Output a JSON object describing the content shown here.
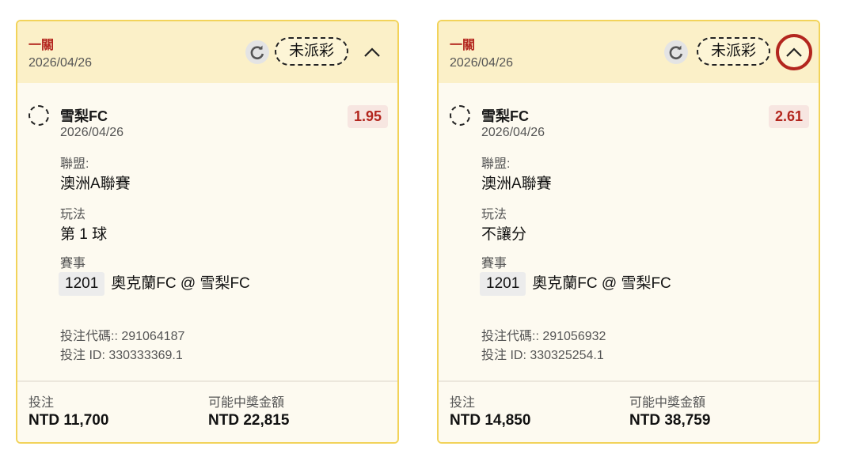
{
  "cards": [
    {
      "bet_type": "一關",
      "date": "2026/04/26",
      "status": "未派彩",
      "selection": {
        "team": "雪梨FC",
        "date": "2026/04/26",
        "odds": "1.95",
        "league_label": "聯盟:",
        "league": "澳洲A聯賽",
        "play_label": "玩法",
        "play": "第 1 球",
        "match_label": "賽事",
        "match_no": "1201",
        "match": "奧克蘭FC @ 雪梨FC",
        "bet_code": "投注代碼:: 291064187",
        "bet_id": "投注 ID: 330333369.1"
      },
      "stake_label": "投注",
      "stake": "NTD 11,700",
      "payout_label": "可能中獎金額",
      "payout": "NTD 22,815"
    },
    {
      "bet_type": "一關",
      "date": "2026/04/26",
      "status": "未派彩",
      "selection": {
        "team": "雪梨FC",
        "date": "2026/04/26",
        "odds": "2.61",
        "league_label": "聯盟:",
        "league": "澳洲A聯賽",
        "play_label": "玩法",
        "play": "不讓分",
        "match_label": "賽事",
        "match_no": "1201",
        "match": "奧克蘭FC @ 雪梨FC",
        "bet_code": "投注代碼:: 291056932",
        "bet_id": "投注 ID: 330325254.1"
      },
      "stake_label": "投注",
      "stake": "NTD 14,850",
      "payout_label": "可能中獎金額",
      "payout": "NTD 38,759"
    }
  ],
  "icons": {
    "refresh": "refresh-icon",
    "collapse": "chevron-up-icon",
    "selection": "dashed-circle-icon"
  },
  "colors": {
    "accent_red": "#b3261e",
    "card_border": "#f2d35a",
    "header_bg": "#fbf0c8",
    "card_bg": "#fdfaf0"
  }
}
